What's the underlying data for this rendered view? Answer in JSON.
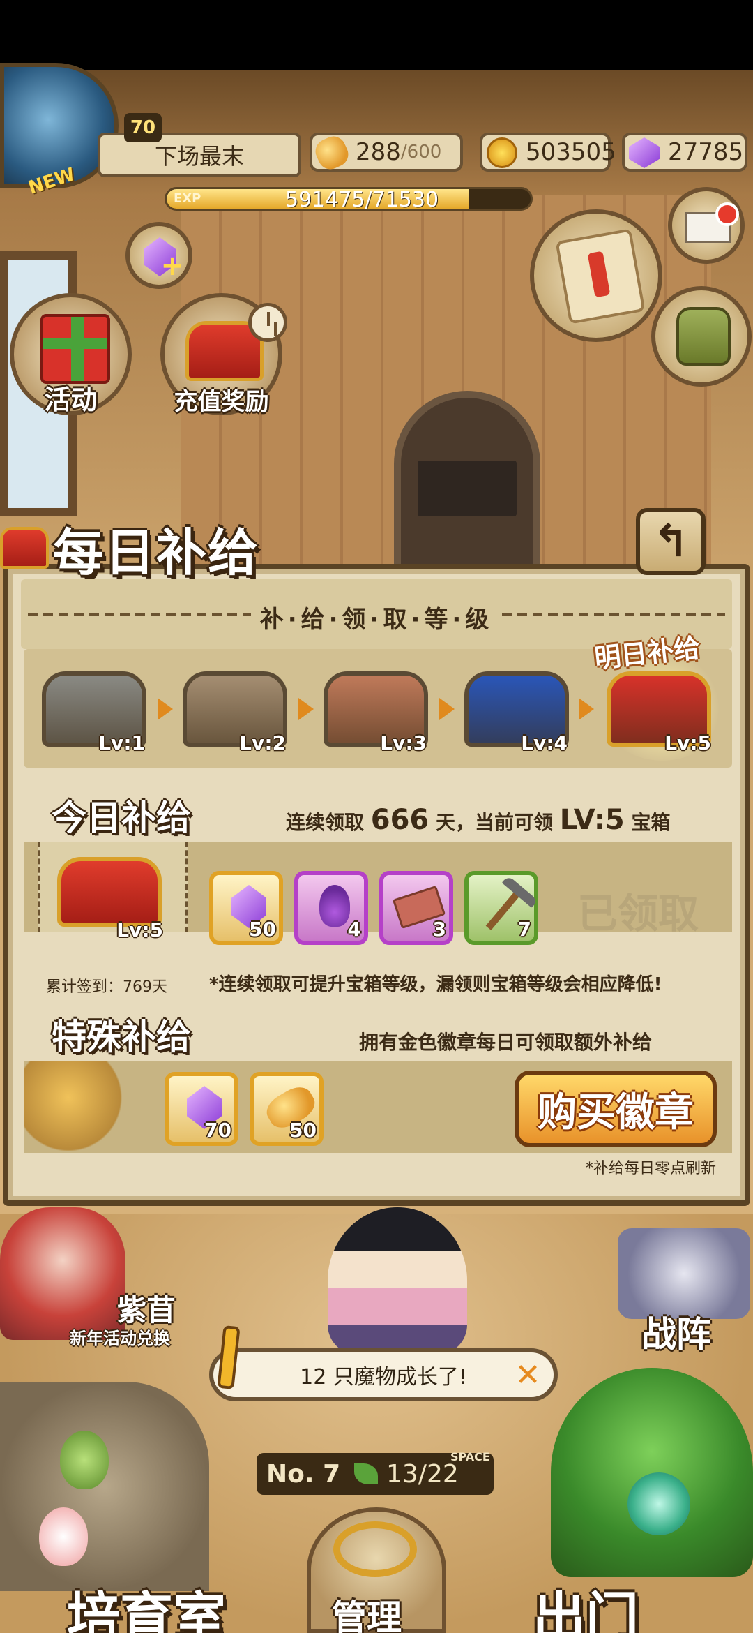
{
  "hud": {
    "rank_title": "下场最末",
    "player_level": "70",
    "new_tag": "NEW",
    "exp_label": "EXP",
    "exp_text": "591475/71530",
    "exp_progress": 0.83,
    "bread_value": "288",
    "bread_max": "/600",
    "gold_value": "503505",
    "gem_value": "27785"
  },
  "side_icons": {
    "activity_label": "活动",
    "recharge_label": "充值奖励"
  },
  "daily_supply": {
    "title": "每日补给",
    "back_symbol": "↰",
    "level_heading": "补·给·领·取·等·级",
    "tomorrow_tag": "明日补给",
    "levels": [
      {
        "label": "Lv:1",
        "color": "#8a8a84"
      },
      {
        "label": "Lv:2",
        "color": "#a58e72"
      },
      {
        "label": "Lv:3",
        "color": "#c07a5a"
      },
      {
        "label": "Lv:4",
        "color": "#2a56b8"
      },
      {
        "label": "Lv:5",
        "color": "#d8322a"
      }
    ],
    "today": {
      "heading": "今日补给",
      "streak_prefix": "连续领取",
      "streak_days": "666",
      "streak_suffix": "天，当前可领",
      "current_level": "LV:5",
      "chest_word": "宝箱",
      "chest_label": "Lv:5",
      "items": [
        {
          "name": "gem",
          "qty": "50"
        },
        {
          "name": "potion",
          "qty": "4"
        },
        {
          "name": "ticket",
          "qty": "3"
        },
        {
          "name": "pickaxe",
          "qty": "7"
        }
      ],
      "claimed_label": "已领取"
    },
    "total_signin": "累计签到：769天",
    "note": "*连续领取可提升宝箱等级，漏领则宝箱等级会相应降低!",
    "special": {
      "heading": "特殊补给",
      "desc": "拥有金色徽章每日可领取额外补给",
      "items": [
        {
          "name": "gem",
          "qty": "70"
        },
        {
          "name": "bread",
          "qty": "50"
        }
      ],
      "buy_label": "购买徽章"
    },
    "refresh_note": "*补给每日零点刷新"
  },
  "scene": {
    "npc_name": "紫苜",
    "npc_sub": "新年活动兑换",
    "formation_label": "战阵",
    "toast_text": "12 只魔物成长了!",
    "toast_close": "✕",
    "counter_no": "No. 7",
    "counter_space": "13/22",
    "space_tag": "SPACE"
  },
  "nav": {
    "nursery_label": "培育室",
    "manage_label": "管理",
    "exit_label": "出门"
  }
}
